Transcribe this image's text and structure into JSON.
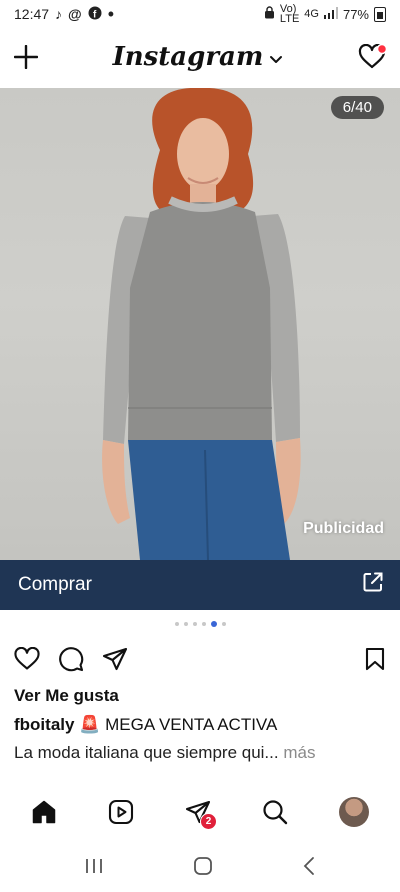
{
  "status_bar": {
    "time": "12:47",
    "network_top": "Vo)",
    "network_bottom": "LTE",
    "network_type": "4G",
    "battery": "77%",
    "icons": [
      "tiktok-icon",
      "threads-icon",
      "facebook-icon",
      "notification-dot-icon",
      "lock-icon",
      "signal-icon",
      "battery-icon"
    ]
  },
  "header": {
    "logo": "Instagram",
    "icons": [
      "plus-icon",
      "chevron-down-icon",
      "heart-icon"
    ],
    "notification_color": "#ff3040"
  },
  "post": {
    "counter": "6/40",
    "sponsored_label": "Publicidad",
    "cta_label": "Comprar",
    "cta_color": "#1f3554",
    "carousel_dots": 6,
    "active_dot": 5,
    "likes_text": "Ver Me gusta",
    "username": "fboitaly",
    "caption_emoji": "🚨",
    "caption_title": "MEGA VENTA ACTIVA",
    "caption_text": "La moda italiana que siempre qui...",
    "more_label": "más"
  },
  "bottom_nav": {
    "items": [
      "home-icon",
      "reels-icon",
      "direct-icon",
      "search-icon",
      "profile-avatar"
    ],
    "direct_badge": "2"
  }
}
